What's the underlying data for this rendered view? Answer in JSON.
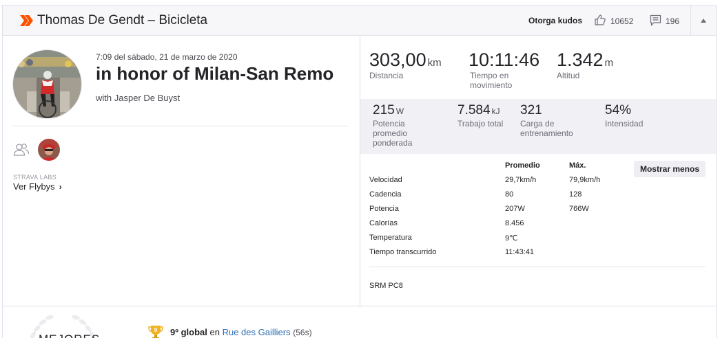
{
  "header": {
    "title": "Thomas De Gendt – Bicicleta",
    "kudos_label": "Otorga kudos",
    "kudos_count": "10652",
    "comment_count": "196",
    "brand_color": "#fc5200"
  },
  "activity": {
    "datetime": "7:09 del sábado, 21 de marzo de 2020",
    "title": "in honor of Milan-San Remo",
    "with": "with Jasper De Buyst",
    "labs_label": "STRAVA LABS",
    "flybys_label": "Ver Flybys",
    "flybys_chevron": "›"
  },
  "primary_stats": [
    {
      "value": "303,00",
      "unit": "km",
      "label": "Distancia"
    },
    {
      "value": "10:11:46",
      "unit": "",
      "label": "Tiempo en movimiento"
    },
    {
      "value": "1.342",
      "unit": "m",
      "label": "Altitud"
    }
  ],
  "secondary_stats": [
    {
      "value": "215",
      "unit": "W",
      "label": "Potencia promedio ponderada"
    },
    {
      "value": "7.584",
      "unit": "kJ",
      "label": "Trabajo total"
    },
    {
      "value": "321",
      "unit": "",
      "label": "Carga de entrenamiento"
    },
    {
      "value": "54%",
      "unit": "",
      "label": "Intensidad"
    }
  ],
  "details": {
    "col_avg": "Promedio",
    "col_max": "Máx.",
    "show_less": "Mostrar menos",
    "rows": [
      {
        "label": "Velocidad",
        "avg": "29,7km/h",
        "max": "79,9km/h"
      },
      {
        "label": "Cadencia",
        "avg": "80",
        "max": "128"
      },
      {
        "label": "Potencia",
        "avg": "207W",
        "max": "766W"
      },
      {
        "label": "Calorías",
        "avg": "8.456",
        "max": ""
      },
      {
        "label": "Temperatura",
        "avg": "9℃",
        "max": ""
      },
      {
        "label": "Tiempo transcurrido",
        "avg": "11:43:41",
        "max": ""
      }
    ],
    "device": "SRM PC8"
  },
  "achievements": {
    "heading": "MEJORES",
    "trophy_rank": "9",
    "rank_text": "9º global",
    "connector": "en",
    "segment": "Rue des Gailliers",
    "time": "(56s)"
  }
}
